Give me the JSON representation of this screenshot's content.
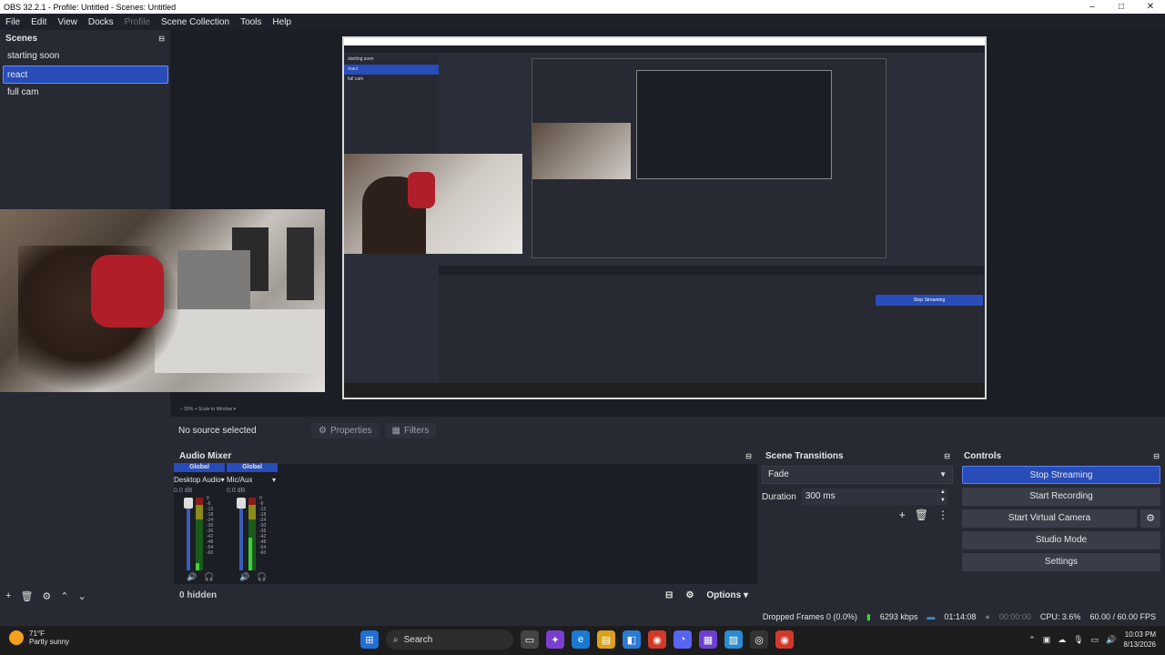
{
  "window": {
    "title": "OBS 32.2.1 - Profile: Untitled - Scenes: Untitled",
    "minimize": "–",
    "maximize": "□",
    "close": "✕"
  },
  "menu": [
    "File",
    "Edit",
    "View",
    "Docks",
    "Profile",
    "Scene Collection",
    "Tools",
    "Help"
  ],
  "scenes": {
    "title": "Scenes",
    "items": [
      "starting soon",
      "react",
      "full cam"
    ],
    "selected_index": 1,
    "float_icon": "⊟"
  },
  "preview_footer": "−   55%   +   Scale to Window   ▾",
  "source_bar": {
    "no_source": "No source selected",
    "properties": "Properties",
    "filters": "Filters"
  },
  "audio_mixer": {
    "title": "Audio Mixer",
    "channels": [
      {
        "global": "Global",
        "name": "Desktop Audio",
        "db": "0.0 dB",
        "level": 0.1
      },
      {
        "global": "Global",
        "name": "Mic/Aux",
        "db": "0.0 dB",
        "level": 0.45
      }
    ],
    "ticks": [
      "0",
      "-6",
      "-12",
      "-18",
      "-24",
      "-30",
      "-36",
      "-42",
      "-48",
      "-54",
      "-60"
    ],
    "hidden": "0 hidden",
    "options": "Options"
  },
  "transitions": {
    "title": "Scene Transitions",
    "selected": "Fade",
    "duration_label": "Duration",
    "duration_value": "300 ms"
  },
  "controls": {
    "title": "Controls",
    "stop_streaming": "Stop Streaming",
    "start_recording": "Start Recording",
    "start_virtual_camera": "Start Virtual Camera",
    "studio_mode": "Studio Mode",
    "settings": "Settings"
  },
  "status": {
    "dropped": "Dropped Frames 0 (0.0%)",
    "bitrate": "6293 kbps",
    "stream_time": "01:14:08",
    "rec_time": "00:00:00",
    "cpu": "CPU: 3.6%",
    "fps": "60.00 / 60.00 FPS"
  },
  "taskbar": {
    "temp": "71°F",
    "weather": "Partly sunny",
    "search": "Search",
    "time": "10:03 PM",
    "date": "8/13/2026"
  },
  "nested": {
    "mini_scenes": [
      "starting soon",
      "react",
      "full cam"
    ],
    "mini_stop": "Stop Streaming"
  },
  "colors": {
    "accent": "#284cb8",
    "dock_bg": "#272a33",
    "canvas_bg": "#1c1e26"
  }
}
